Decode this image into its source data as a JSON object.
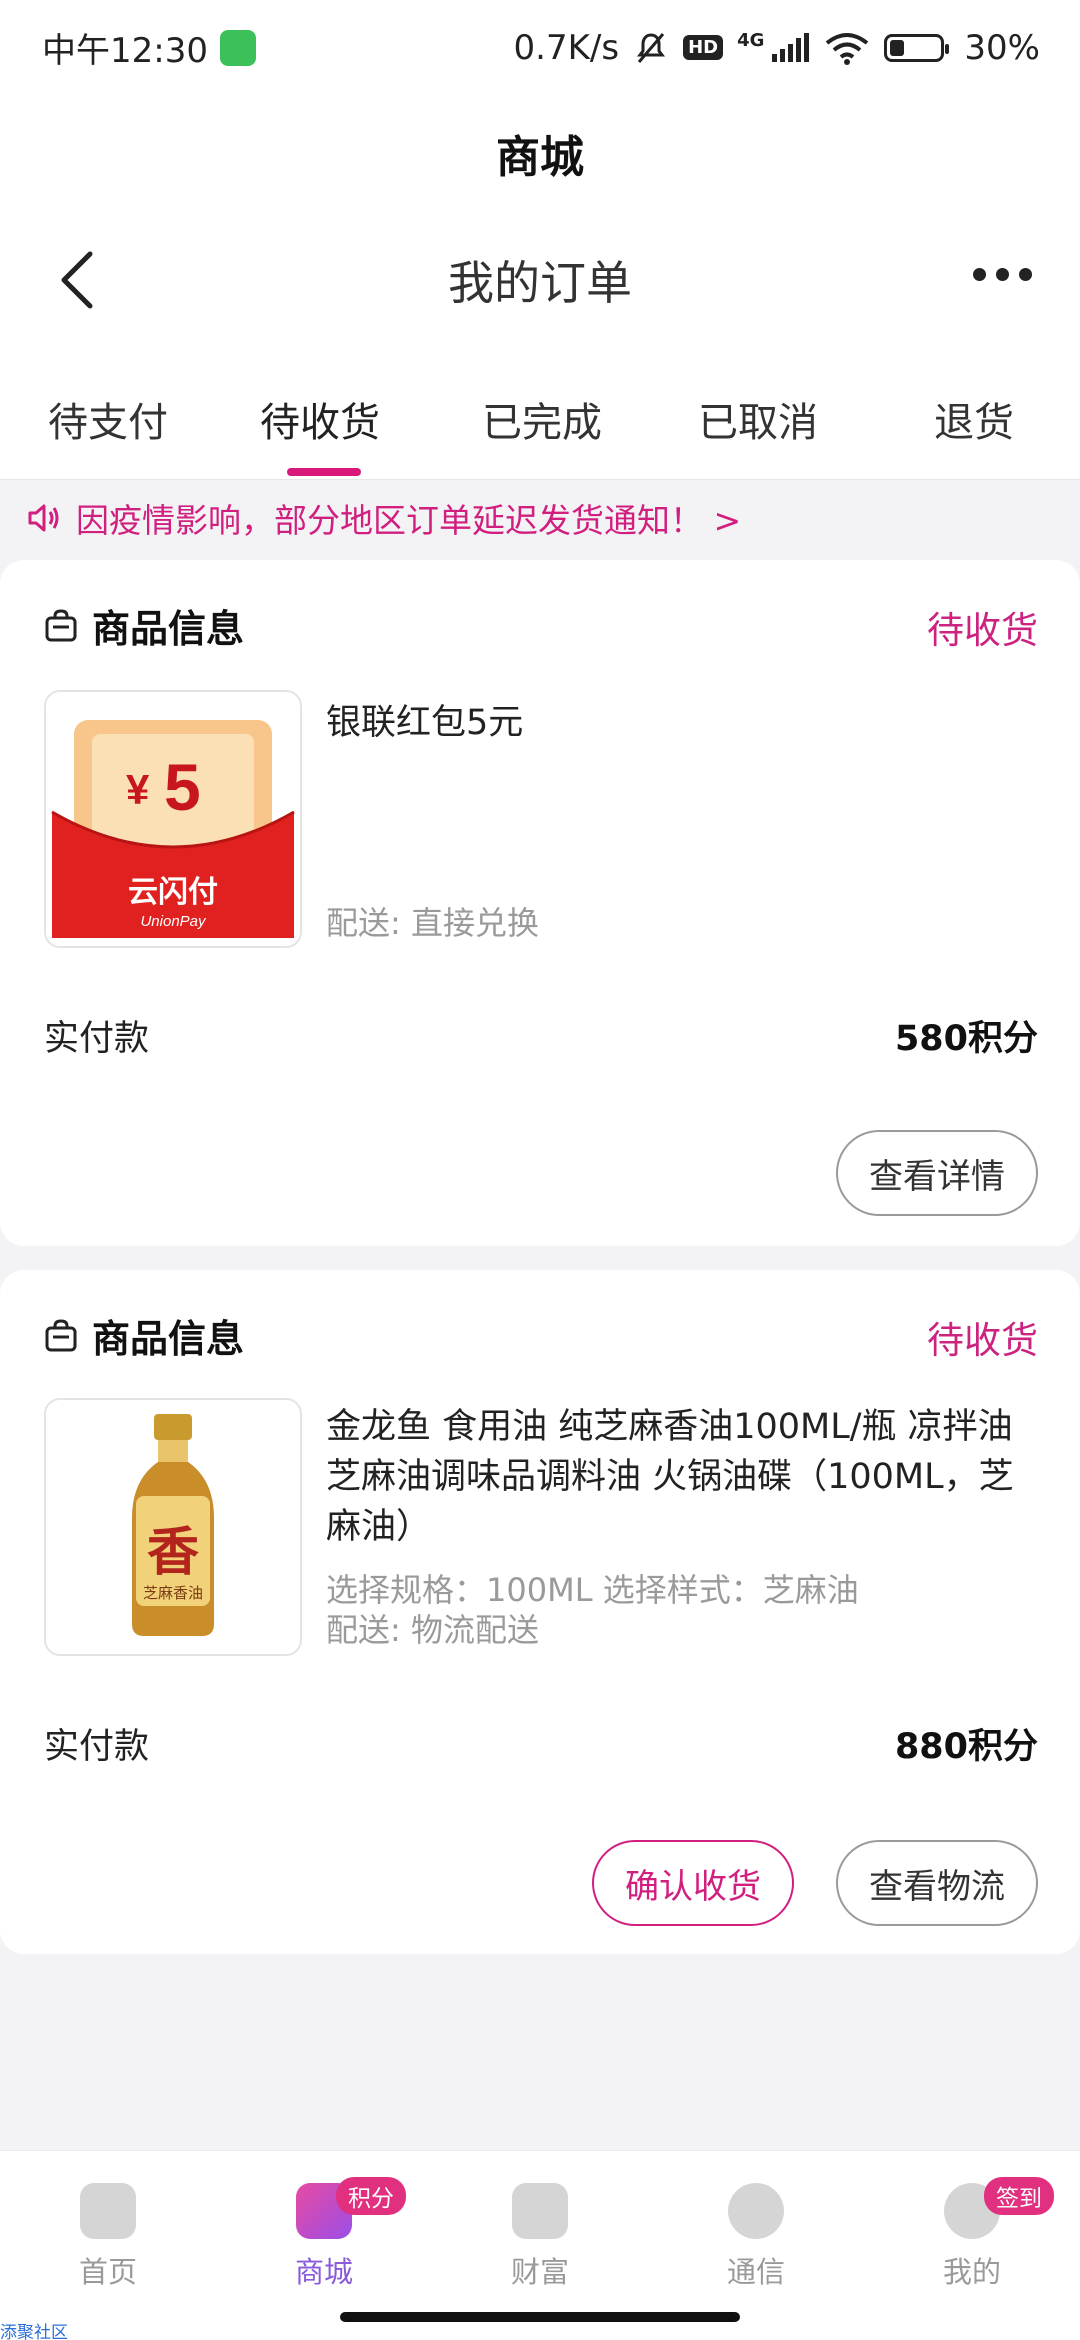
{
  "status_bar": {
    "time": "中午12:30",
    "net_speed": "0.7K/s",
    "hd": "HD",
    "network": "4G",
    "battery": "30%"
  },
  "app_title": "商城",
  "nav": {
    "title": "我的订单"
  },
  "tabs": [
    {
      "label": "待支付"
    },
    {
      "label": "待收货",
      "active": true
    },
    {
      "label": "已完成"
    },
    {
      "label": "已取消"
    },
    {
      "label": "退货"
    }
  ],
  "notice": {
    "text": "因疫情影响，部分地区订单延迟发货通知！ >"
  },
  "orders": [
    {
      "header": "商品信息",
      "status": "待收货",
      "thumb": {
        "amount": "5",
        "currency": "¥",
        "brand": "云闪付",
        "brand_en": "UnionPay"
      },
      "title": "银联红包5元",
      "spec": "",
      "delivery": "配送: 直接兑换",
      "pay_label": "实付款",
      "pay_value": "580积分",
      "buttons": [
        "查看详情"
      ]
    },
    {
      "header": "商品信息",
      "status": "待收货",
      "thumb": {
        "label": "香",
        "sub": "芝麻香油"
      },
      "title": "金龙鱼 食用油 纯芝麻香油100ML/瓶 凉拌油芝麻油调味品调料油 火锅油碟（100ML，芝麻油）",
      "spec": "选择规格：100ML  选择样式：芝麻油",
      "delivery": "配送: 物流配送",
      "pay_label": "实付款",
      "pay_value": "880积分",
      "buttons": [
        "确认收货",
        "查看物流"
      ]
    }
  ],
  "bottom_nav": [
    {
      "label": "首页"
    },
    {
      "label": "商城",
      "badge": "积分",
      "active": true
    },
    {
      "label": "财富"
    },
    {
      "label": "通信"
    },
    {
      "label": "我的",
      "badge": "签到"
    }
  ],
  "watermark": "添聚社区",
  "colors": {
    "accent": "#d11f80",
    "active_nav": "#8a5bd8"
  }
}
